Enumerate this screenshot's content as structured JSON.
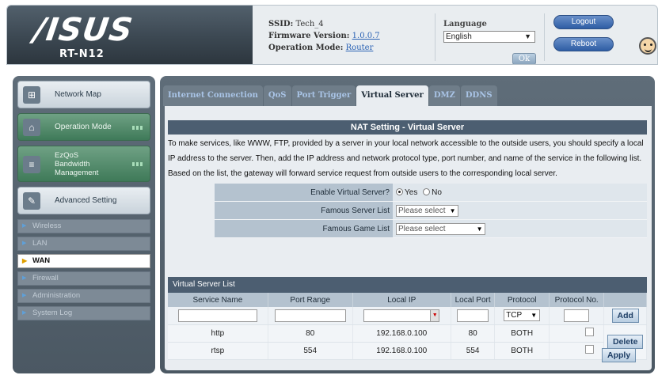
{
  "header": {
    "logo": "/ISUS",
    "model": "RT-N12",
    "ssid_label": "SSID:",
    "ssid_value": "Tech_4",
    "firmware_label": "Firmware Version:",
    "firmware_value": "1.0.0.7",
    "opmode_label": "Operation Mode:",
    "opmode_value": "Router",
    "language_label": "Language",
    "language_value": "English",
    "ok_label": "Ok",
    "logout_label": "Logout",
    "reboot_label": "Reboot"
  },
  "sidebar": {
    "items": [
      {
        "label": "Network Map",
        "icon": "network-map-icon"
      },
      {
        "label": "Operation Mode",
        "icon": "router-icon"
      },
      {
        "label_lines": [
          "EzQoS",
          "Bandwidth",
          "Management"
        ],
        "icon": "qos-icon"
      },
      {
        "label": "Advanced Setting",
        "icon": "tools-icon"
      }
    ],
    "sub_items": [
      "Wireless",
      "LAN",
      "WAN",
      "Firewall",
      "Administration",
      "System Log"
    ],
    "active_sub": "WAN"
  },
  "tabs": [
    "Internet Connection",
    "QoS",
    "Port Trigger",
    "Virtual Server",
    "DMZ",
    "DDNS"
  ],
  "active_tab": "Virtual Server",
  "panel": {
    "title": "NAT Setting - Virtual Server",
    "description": "To make services, like WWW, FTP, provided by a server in your local network accessible to the outside users, you should specify a local IP address to the server. Then, add the IP address and network protocol type, port number, and name of the service in the following list. Based on the list, the gateway will forward service request from outside users to the corresponding local server.",
    "enable_label": "Enable Virtual Server?",
    "enable_yes": "Yes",
    "enable_no": "No",
    "famous_server_label": "Famous Server List",
    "famous_server_value": "Please select",
    "famous_game_label": "Famous Game List",
    "famous_game_value": "Please select",
    "list_title": "Virtual Server List",
    "columns": [
      "Service Name",
      "Port Range",
      "Local IP",
      "Local Port",
      "Protocol",
      "Protocol No."
    ],
    "new_protocol": "TCP",
    "rows": [
      {
        "service": "http",
        "port_range": "80",
        "local_ip": "192.168.0.100",
        "local_port": "80",
        "protocol": "BOTH"
      },
      {
        "service": "rtsp",
        "port_range": "554",
        "local_ip": "192.168.0.100",
        "local_port": "554",
        "protocol": "BOTH"
      }
    ],
    "add_label": "Add",
    "delete_label": "Delete",
    "apply_label": "Apply"
  }
}
